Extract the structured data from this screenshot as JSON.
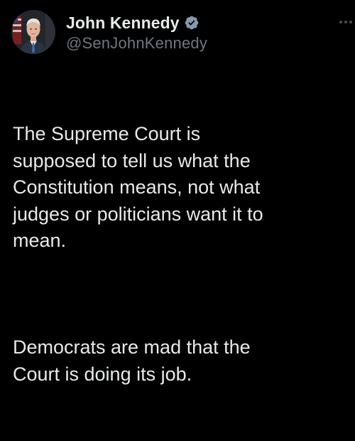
{
  "tweet": {
    "author": {
      "display_name": "John Kennedy",
      "handle": "@SenJohnKennedy",
      "verified": true,
      "verified_icon": "verified-badge-icon"
    },
    "paragraphs": [
      "The Supreme Court is\nsupposed to tell us what the\nConstitution means, not what\njudges or politicians want it to\nmean.",
      "Democrats are mad that the\nCourt is doing its job."
    ],
    "more_icon": "more-options-icon"
  },
  "colors": {
    "background": "#000000",
    "text_primary": "#e7e9ea",
    "text_secondary": "#71767b",
    "verified_badge": "#829aab"
  }
}
